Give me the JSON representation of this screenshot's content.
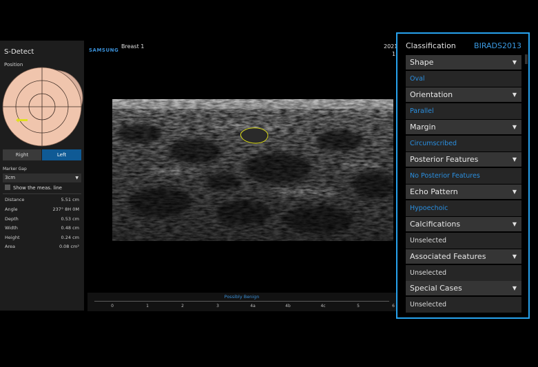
{
  "left_panel": {
    "title": "S-Detect",
    "position_label": "Position",
    "side_buttons": {
      "right": "Right",
      "left": "Left"
    },
    "marker_gap": {
      "label": "Marker Gap",
      "value": "3cm"
    },
    "show_meas_label": "Show the meas. line",
    "measurements": [
      {
        "name": "Distance",
        "value": "5.51 cm"
      },
      {
        "name": "Angle",
        "value": "237° 8H 0M"
      },
      {
        "name": "Depth",
        "value": "0.53 cm"
      },
      {
        "name": "Width",
        "value": "0.48 cm"
      },
      {
        "name": "Height",
        "value": "0.24 cm"
      },
      {
        "name": "Area",
        "value": "0.08 cm²"
      }
    ]
  },
  "header": {
    "brand": "SAMSUNG",
    "study": "Breast 1",
    "date_line1": "2021",
    "date_line2": "1"
  },
  "result_bar": {
    "result": "Possibly Benign",
    "scale": [
      "0",
      "1",
      "2",
      "3",
      "4a",
      "4b",
      "4c",
      "5",
      "6"
    ]
  },
  "classification": {
    "title": "Classification",
    "mode": "BIRADS2013",
    "categories": [
      {
        "name": "Shape",
        "value": "Oval",
        "selected": true
      },
      {
        "name": "Orientation",
        "value": "Parallel",
        "selected": true
      },
      {
        "name": "Margin",
        "value": "Circumscribed",
        "selected": true
      },
      {
        "name": "Posterior Features",
        "value": "No Posterior Features",
        "selected": true
      },
      {
        "name": "Echo Pattern",
        "value": "Hypoechoic",
        "selected": true
      },
      {
        "name": "Calcifications",
        "value": "Unselected",
        "selected": false
      },
      {
        "name": "Associated Features",
        "value": "Unselected",
        "selected": false
      },
      {
        "name": "Special Cases",
        "value": "Unselected",
        "selected": false
      }
    ]
  },
  "colors": {
    "accent": "#27a3ef",
    "selected_text": "#2a8fe0",
    "left_button_active": "#0f5a95",
    "lesion_outline": "#d8d818"
  },
  "icons": {
    "dropdown": "triangle-down-icon",
    "checkbox": "checkbox-icon",
    "probe_marker": "probe-marker-icon"
  }
}
